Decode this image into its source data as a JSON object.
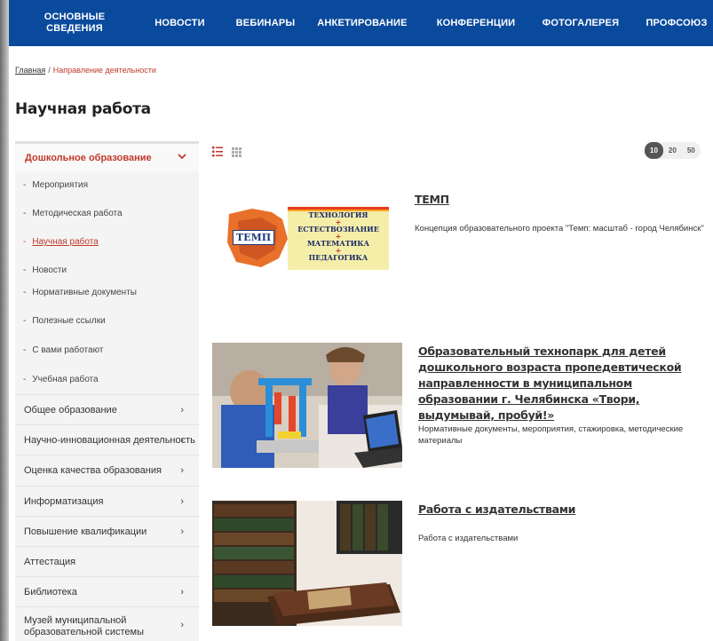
{
  "nav": {
    "items": [
      "ОСНОВНЫЕ СВЕДЕНИЯ",
      "НОВОСТИ",
      "ВЕБИНАРЫ",
      "АНКЕТИРОВАНИЕ",
      "КОНФЕРЕНЦИИ",
      "ФОТОГАЛЕРЕЯ",
      "ПРОФСОЮЗ"
    ]
  },
  "breadcrumb": {
    "home": "Главная",
    "sep": "/",
    "current": "Направление деятельности"
  },
  "page_title": "Научная работа",
  "sidebar": {
    "expanded": "Дошкольное образование",
    "subitems": [
      "Мероприятия",
      "Методическая работа",
      "Научная работа",
      "Новости",
      "Нормативные документы",
      "Полезные ссылки",
      "С вами работают",
      "Учебная работа"
    ],
    "items": [
      "Общее образование",
      "Научно-инновационная деятельность",
      "Оценка качества образования",
      "Информатизация",
      "Повышение квалификации",
      "Аттестация",
      "Библиотека",
      "Музей муниципальной образовательной системы"
    ]
  },
  "pager": [
    "10",
    "20",
    "50"
  ],
  "thumb1": {
    "word": "ТЕМП",
    "lines": [
      "ТЕХНОЛОГИЯ",
      "+",
      "ЕСТЕСТВОЗНАНИЕ",
      "+",
      "МАТЕМАТИКА",
      "+",
      "ПЕДАГОГИКА"
    ]
  },
  "articles": [
    {
      "title": "ТЕМП",
      "desc": "Концепция образовательного проекта \"Темп: масштаб - город Челябинск\""
    },
    {
      "title": "Образовательный технопарк для детей дошкольного возраста пропедевтической направленности в муниципальном образовании г. Челябинска «Твори, выдумывай, пробуй!»",
      "desc": "Нормативные документы, мероприятия, стажировка, методические материалы"
    },
    {
      "title": "Работа с издательствами",
      "desc": "Работа с издательствами"
    }
  ]
}
